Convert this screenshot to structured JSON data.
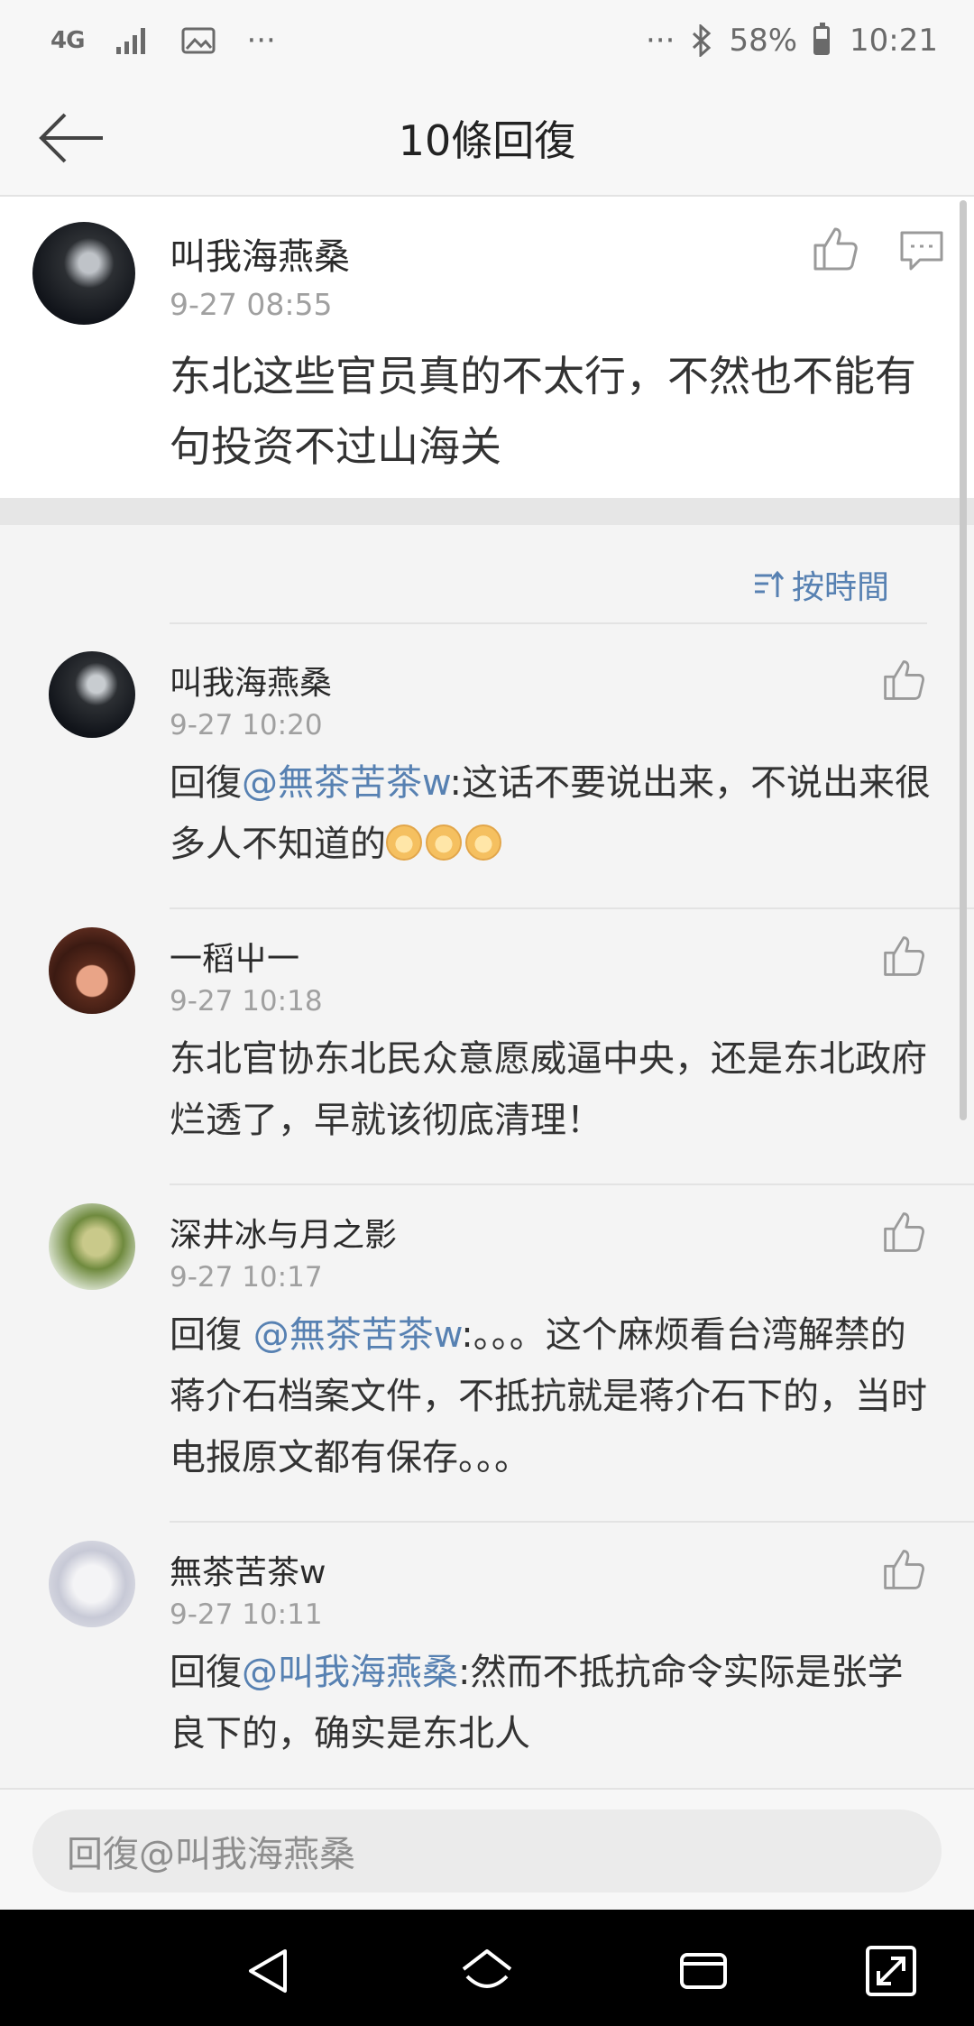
{
  "status_bar": {
    "network": "4G",
    "battery_percent": "58%",
    "time": "10:21",
    "overflow": "···"
  },
  "header": {
    "title": "10條回復"
  },
  "main_post": {
    "author": "叫我海燕桑",
    "time": "9-27 08:55",
    "text": "东北这些官员真的不太行，不然也不能有句投资不过山海关"
  },
  "sort": {
    "label": "按時間"
  },
  "replies": [
    {
      "author": "叫我海燕桑",
      "time": "9-27 10:20",
      "prefix": "回復",
      "mention": "@無茶苦茶w",
      "text": ":这话不要说出来，不说出来很多人不知道的",
      "emoji_count": 3
    },
    {
      "author": "一稻屮一",
      "time": "9-27 10:18",
      "prefix": "",
      "mention": "",
      "text": "东北官协东北民众意愿威逼中央，还是东北政府烂透了，早就该彻底清理！"
    },
    {
      "author": "深井冰与月之影",
      "time": "9-27 10:17",
      "prefix": "回復 ",
      "mention": "@無茶苦茶w",
      "text": ":。。。这个麻烦看台湾解禁的蒋介石档案文件，不抵抗就是蒋介石下的，当时电报原文都有保存。。。"
    },
    {
      "author": "無茶苦茶w",
      "time": "9-27 10:11",
      "prefix": "回復",
      "mention": "@叫我海燕桑",
      "text": ":然而不抵抗命令实际是张学良下的，确实是东北人"
    }
  ],
  "input": {
    "placeholder": "回復@叫我海燕桑"
  },
  "colors": {
    "link": "#5781b2",
    "background": "#f4f4f4"
  }
}
